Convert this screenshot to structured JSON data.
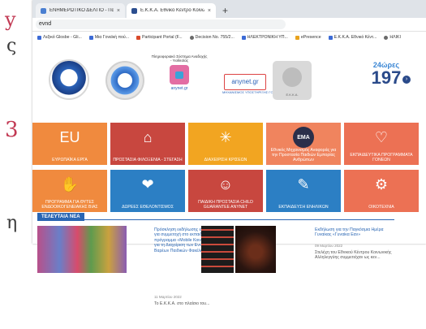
{
  "slide": {
    "fragments": [
      "y",
      "ς",
      "3",
      "η"
    ]
  },
  "browser": {
    "tabs": [
      {
        "label": "ΕΝΗΜΕΡΩΤΙΚΟ ΔΕΛΤΙΟ - Παρου",
        "close": "×"
      },
      {
        "label": "Ε.Κ.Κ.Α. Εθνικό Κέντρο Κοινωνι",
        "close": "×"
      }
    ],
    "new_tab": "+",
    "address": "evnd",
    "bookmarks": [
      "Λεξικό Glosbe - Gli...",
      "Μια Γονεϊκή πού...",
      "Participant Portal (F...",
      "Decision No. 755/2...",
      "ΗΛΕΚΤΡΟΝΙΚΗ ΥΠ...",
      "ePresence",
      "Ε.Κ.Κ.Α. Εθνικό Κέντ...",
      "ΗΛΙΚΙ"
    ]
  },
  "logos": {
    "heart_caption": "Πληροφοριακό Σύστημα Αναδοχής - Υιοθεσίας",
    "heart_domain": "anynet.gr",
    "anynet_label": "anynet.gr",
    "anynet_under": "ΜΗΧΑΝΙΣΜΟΣ ΥΠΟΣΤΗΡΙΞΗΣ ΓΟΝΕΩΝ",
    "ekka_label": "Ε.Κ.Κ.Α.",
    "hotline_top": "24ώρες",
    "hotline_number": "197",
    "hotline_arrow": "›"
  },
  "tiles": [
    {
      "label": "ΕΥΡΩΠΑΪΚΑ ΕΡΓΑ",
      "icon": "eu-flag-icon",
      "glyph": "EU",
      "color": "#f08a3e"
    },
    {
      "label": "ΠΡΟΣΤΑΣΙΑ ΦΙΛΟΞΕΝΙΑ - ΣΤΕΓΑΣΗ",
      "icon": "bed-icon",
      "glyph": "⌂",
      "color": "#c8473f"
    },
    {
      "label": "ΔΙΑΧΕΙΡΙΣΗ ΚΡΙΣΕΩΝ",
      "icon": "network-icon",
      "glyph": "✳",
      "color": "#f2a521"
    },
    {
      "label": "Εθνικός Μηχανισμός Αναφοράς για την Προστασία Παιδιών Εμπορίας Ανθρώπων",
      "icon": "ema-logo-icon",
      "glyph": "EMA",
      "color": "#f0845e"
    },
    {
      "label": "ΕΚΠΑΙΔΕΥΤΙΚΑ ΠΡΟΓΡΑΜΜΑΤΑ ΓΟΝΕΩΝ",
      "icon": "home-heart-icon",
      "glyph": "♡",
      "color": "#ec7154"
    },
    {
      "label": "ΠΡΟΓΡΑΜΜΑ ΓΙΑ ΘΥΤΕΣ ΕΝΔΟΟΙΚΟΓΕΝΕΙΑΚΗΣ ΒΙΑΣ",
      "icon": "hand-icon",
      "glyph": "✋",
      "color": "#f08a3e"
    },
    {
      "label": "ΔΩΡΕΕΣ ΕΘΕΛΟΝΤΙΣΜΟΣ",
      "icon": "heart-hand-icon",
      "glyph": "❤",
      "color": "#2c7fc4"
    },
    {
      "label": "ΠΑΙΔΙΚΗ ΠΡΟΣΤΑΣΙΑ CHILD GUARANTEE ANYNET",
      "icon": "children-icon",
      "glyph": "☺",
      "color": "#c8473f"
    },
    {
      "label": "ΕΚΠΑΙΔΕΥΣΗ ΕΝΗΛΙΚΩΝ",
      "icon": "teacher-icon",
      "glyph": "✎",
      "color": "#2c7fc4"
    },
    {
      "label": "ΟΙΚΟΤΕΧΝΙΑ",
      "icon": "loom-icon",
      "glyph": "⚙",
      "color": "#ec7154"
    }
  ],
  "news": {
    "heading": "ΤΕΛΕΥΤΑΙΑ ΝΕΑ",
    "items": [
      {
        "title": "Πρόσκληση εκδήλωσης ενδιαφέροντος για συμμετοχή στο εκπαιδευτικό πρόγραμμα «Mobile Κοινωνική Εργασία για τη Διαχείριση των Ενοποιημένων Βαρέων Παιδικών Φακέλων»",
        "date": "11 Μαρτίου 2022",
        "excerpt": "Το Ε.Κ.Κ.Α. στο πλαίσιο του..."
      },
      {
        "title": "Εκδήλωση για την Παγκόσμια Ημέρα Γυναίκας «Γυναίκα Εαν»",
        "date": "09 Μαρτίου 2022",
        "excerpt": "Στελέχη του Εθνικού Κέντρου Κοινωνικής Αλληλεγγύης συμμετείχαν ως κεν..."
      }
    ]
  }
}
